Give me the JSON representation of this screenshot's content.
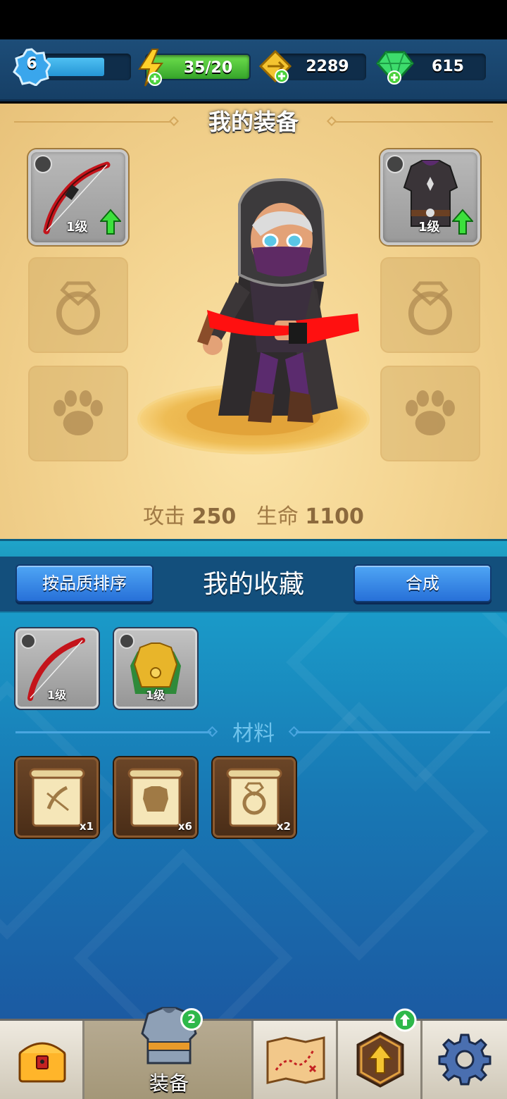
{
  "topbar": {
    "level": "6",
    "energy": "35/20",
    "gold": "2289",
    "gems": "615"
  },
  "equipment": {
    "title": "我的装备",
    "weapon_level": "1级",
    "armor_level": "1级",
    "stats": {
      "attack_label": "攻击",
      "attack_value": "250",
      "hp_label": "生命",
      "hp_value": "1100"
    }
  },
  "collection": {
    "sort_button": "按品质排序",
    "title": "我的收藏",
    "merge_button": "合成",
    "items": [
      {
        "icon": "bow-icon",
        "level": "1级"
      },
      {
        "icon": "gold-armor-icon",
        "level": "1级"
      }
    ],
    "materials_title": "材料",
    "materials": [
      {
        "icon": "bow-scroll-icon",
        "count": "x1"
      },
      {
        "icon": "armor-scroll-icon",
        "count": "x6"
      },
      {
        "icon": "ring-scroll-icon",
        "count": "x2"
      }
    ]
  },
  "nav": {
    "equip_label": "装备",
    "equip_badge": "2",
    "colors": {
      "active": "#a49778",
      "inactive": "#efeae0"
    }
  }
}
